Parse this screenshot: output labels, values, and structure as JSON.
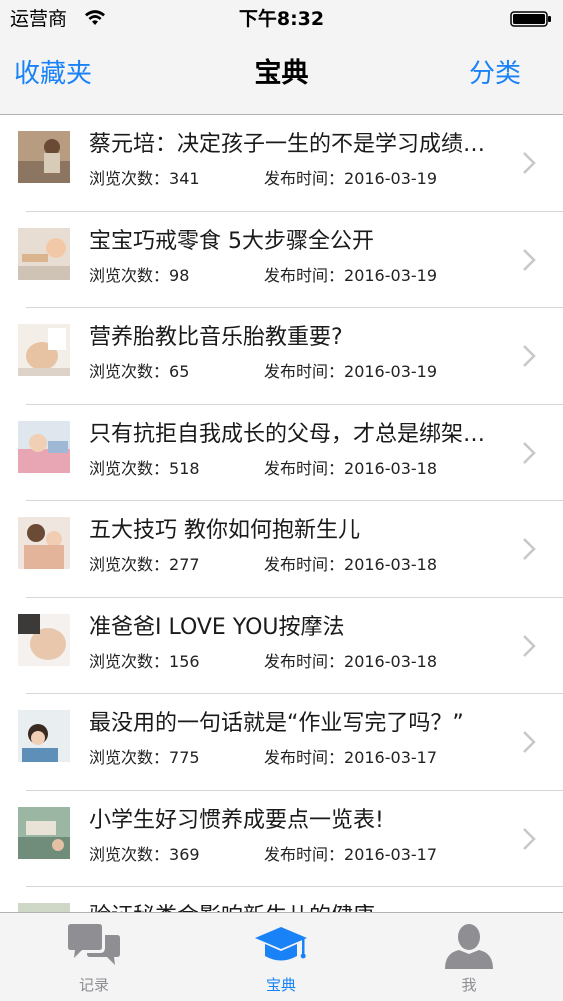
{
  "status_bar": {
    "carrier": "运营商",
    "time": "下午8:32"
  },
  "nav": {
    "left_label": "收藏夹",
    "title": "宝典",
    "right_label": "分类"
  },
  "list": {
    "views_label": "浏览次数：",
    "date_label": "发布时间：",
    "items": [
      {
        "title": "蔡元培：决定孩子一生的不是学习成绩…",
        "views": "341",
        "date": "2016-03-19"
      },
      {
        "title": "宝宝巧戒零食 5大步骤全公开",
        "views": "98",
        "date": "2016-03-19"
      },
      {
        "title": "营养胎教比音乐胎教重要?",
        "views": "65",
        "date": "2016-03-19"
      },
      {
        "title": "只有抗拒自我成长的父母，才总是绑架…",
        "views": "518",
        "date": "2016-03-18"
      },
      {
        "title": "五大技巧 教你如何抱新生儿",
        "views": "277",
        "date": "2016-03-18"
      },
      {
        "title": "准爸爸I LOVE YOU按摩法",
        "views": "156",
        "date": "2016-03-18"
      },
      {
        "title": "最没用的一句话就是“作业写完了吗？”",
        "views": "775",
        "date": "2016-03-17"
      },
      {
        "title": "小学生好习惯养成要点一览表!",
        "views": "369",
        "date": "2016-03-17"
      },
      {
        "title": "验证秘类会影响新生儿的健康",
        "views": "",
        "date": ""
      }
    ]
  },
  "tab_bar": {
    "tabs": [
      {
        "label": "记录",
        "icon": "chat-bubbles-icon",
        "active": false
      },
      {
        "label": "宝典",
        "icon": "graduation-cap-icon",
        "active": true
      },
      {
        "label": "我",
        "icon": "person-icon",
        "active": false
      }
    ]
  },
  "colors": {
    "accent": "#1a82f7",
    "bar_background": "#f4f4f5",
    "inactive_tab": "#8e8e93"
  }
}
